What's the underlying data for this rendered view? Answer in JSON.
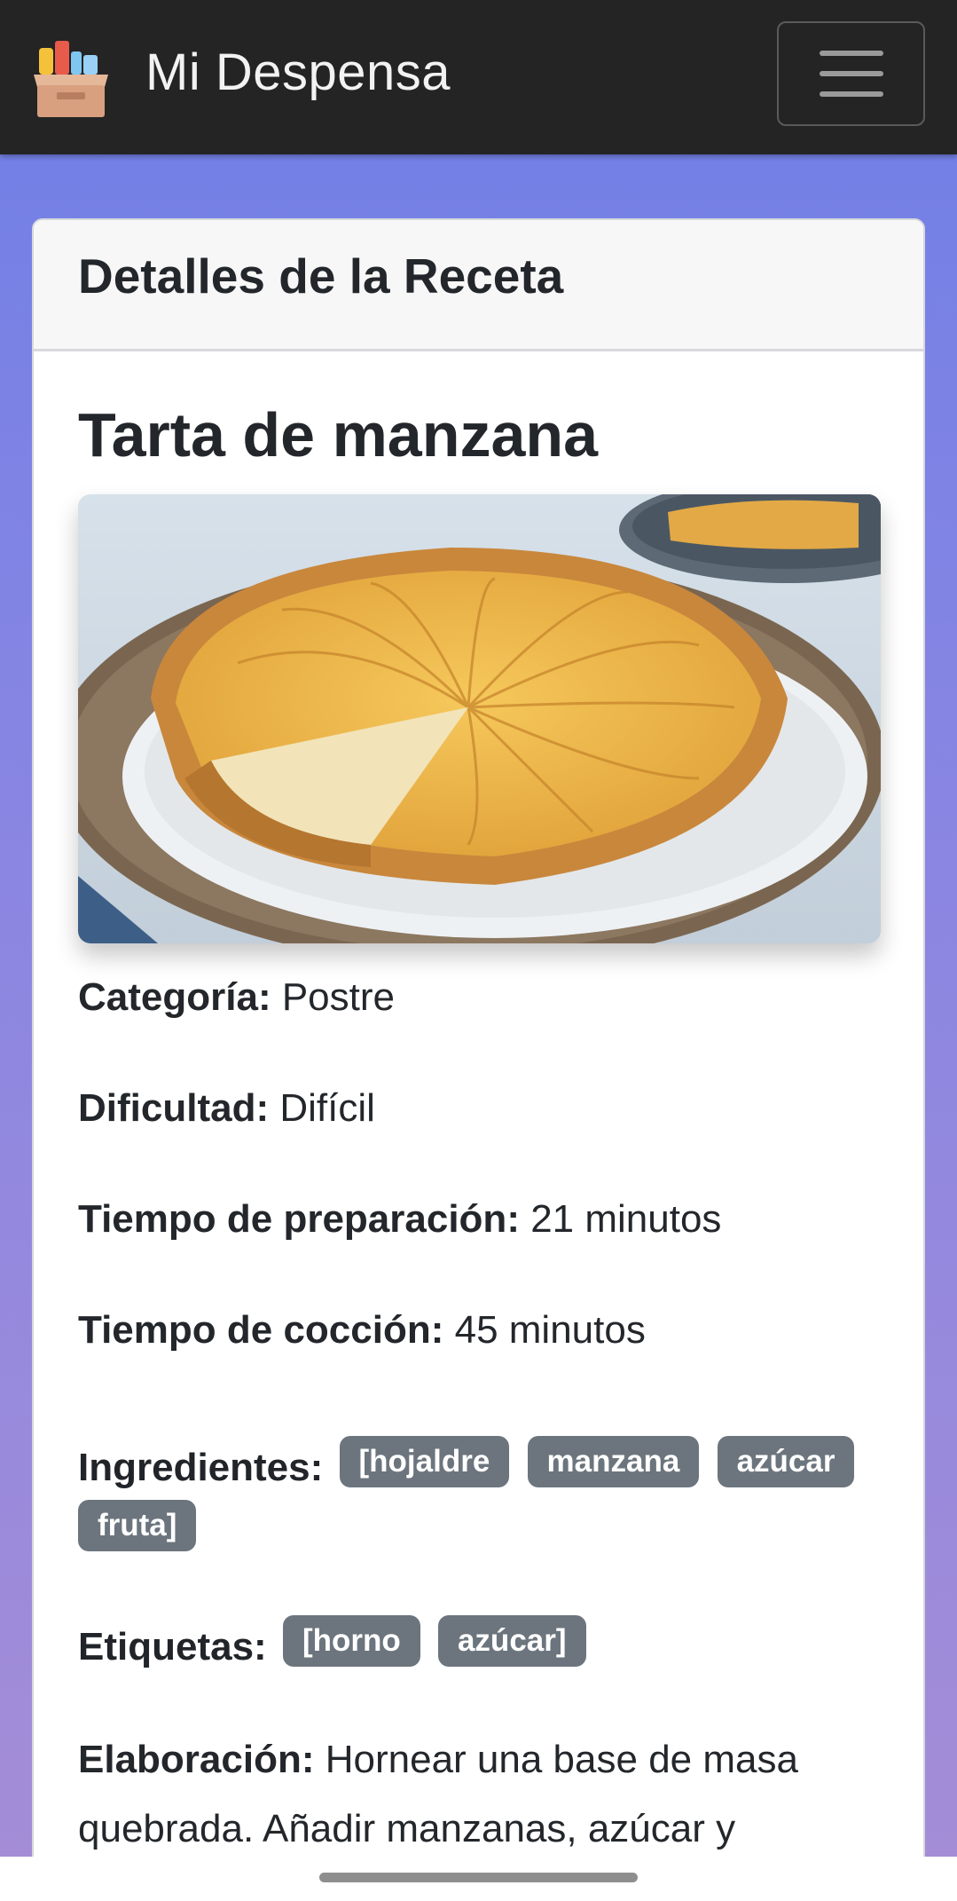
{
  "navbar": {
    "brand_title": "Mi Despensa",
    "logo_icon": "pantry-box-icon",
    "menu_icon": "hamburger-menu-icon"
  },
  "card": {
    "header_title": "Detalles de la Receta",
    "recipe_title": "Tarta de manzana",
    "image_alt": "apple-tart-photo",
    "fields": {
      "categoria": {
        "label": "Categoría:",
        "value": "Postre"
      },
      "dificultad": {
        "label": "Dificultad:",
        "value": "Difícil"
      },
      "preparacion": {
        "label": "Tiempo de preparación:",
        "value": "21 minutos"
      },
      "coccion": {
        "label": "Tiempo de cocción:",
        "value": "45 minutos"
      }
    },
    "ingredientes": {
      "label": "Ingredientes:",
      "items": [
        "[hojaldre",
        "manzana",
        "azúcar",
        "fruta]"
      ]
    },
    "etiquetas": {
      "label": "Etiquetas:",
      "items": [
        "[horno",
        "azúcar]"
      ]
    },
    "elaboracion": {
      "label": "Elaboración:",
      "text": "Hornear una base de masa quebrada. Añadir manzanas, azúcar y"
    }
  },
  "colors": {
    "navbar_bg": "#242424",
    "badge_bg": "#6c757d",
    "page_gradient_top": "#6f7fe6",
    "page_gradient_bottom": "#a58dd6"
  }
}
